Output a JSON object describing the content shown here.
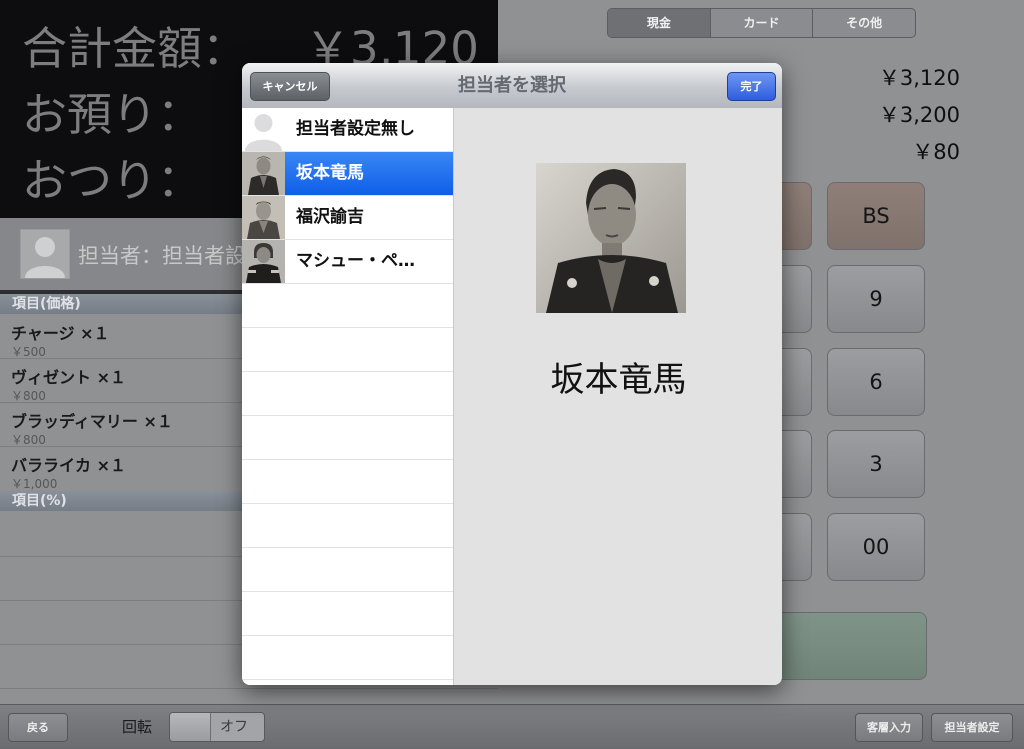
{
  "background": {
    "summary": [
      {
        "label": "合計金額：",
        "value": "￥3,120"
      },
      {
        "label": "お預り：",
        "value": ""
      },
      {
        "label": "おつり：",
        "value": ""
      }
    ],
    "staff_prefix": "担当者：担当者設",
    "sections": {
      "items_header": "項目(価格)",
      "percent_header": "項目(%)"
    },
    "items": [
      {
        "name": "チャージ ×１",
        "price": "￥500"
      },
      {
        "name": "ヴィゼント ×１",
        "price": "￥800"
      },
      {
        "name": "ブラッディマリー ×１",
        "price": "￥800"
      },
      {
        "name": "バラライカ ×１",
        "price": "￥1,000"
      }
    ],
    "payment_tabs": [
      "現金",
      "カード",
      "その他"
    ],
    "amounts": [
      "￥3,120",
      "￥3,200",
      "￥80"
    ],
    "keys": {
      "bs": "BS",
      "k9": "9",
      "k6": "6",
      "k3": "3",
      "k00": "00"
    }
  },
  "bottom_bar": {
    "back": "戻る",
    "rotate_label": "回転",
    "rotate_state": "オフ",
    "customer_input": "客層入力",
    "staff_settings": "担当者設定"
  },
  "modal": {
    "title": "担当者を選択",
    "cancel": "キャンセル",
    "done": "完了",
    "staff": [
      {
        "name": "担当者設定無し",
        "selected": false
      },
      {
        "name": "坂本竜馬",
        "selected": true
      },
      {
        "name": "福沢諭吉",
        "selected": false
      },
      {
        "name": "マシュー・ペ…",
        "selected": false
      }
    ],
    "detail_name": "坂本竜馬"
  },
  "colors": {
    "selection": "#1a6df0",
    "done_button": "#3b67e6",
    "backdrop": "#0d0d0f"
  }
}
